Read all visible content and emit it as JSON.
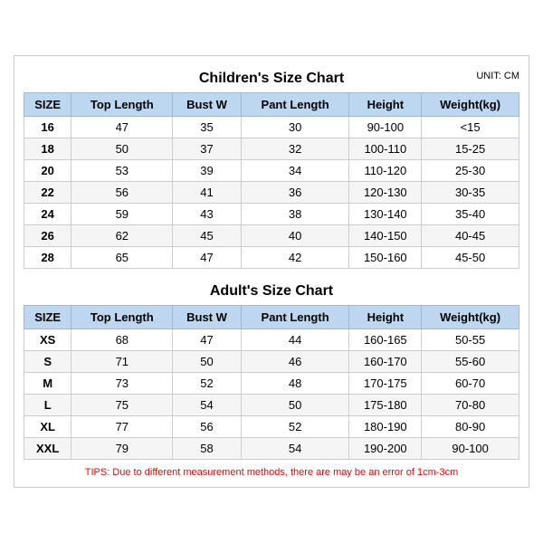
{
  "children": {
    "title": "Children's Size Chart",
    "unit": "UNIT: CM",
    "headers": [
      "SIZE",
      "Top Length",
      "Bust W",
      "Pant Length",
      "Height",
      "Weight(kg)"
    ],
    "rows": [
      [
        "16",
        "47",
        "35",
        "30",
        "90-100",
        "<15"
      ],
      [
        "18",
        "50",
        "37",
        "32",
        "100-110",
        "15-25"
      ],
      [
        "20",
        "53",
        "39",
        "34",
        "110-120",
        "25-30"
      ],
      [
        "22",
        "56",
        "41",
        "36",
        "120-130",
        "30-35"
      ],
      [
        "24",
        "59",
        "43",
        "38",
        "130-140",
        "35-40"
      ],
      [
        "26",
        "62",
        "45",
        "40",
        "140-150",
        "40-45"
      ],
      [
        "28",
        "65",
        "47",
        "42",
        "150-160",
        "45-50"
      ]
    ]
  },
  "adult": {
    "title": "Adult's Size Chart",
    "headers": [
      "SIZE",
      "Top Length",
      "Bust W",
      "Pant Length",
      "Height",
      "Weight(kg)"
    ],
    "rows": [
      [
        "XS",
        "68",
        "47",
        "44",
        "160-165",
        "50-55"
      ],
      [
        "S",
        "71",
        "50",
        "46",
        "160-170",
        "55-60"
      ],
      [
        "M",
        "73",
        "52",
        "48",
        "170-175",
        "60-70"
      ],
      [
        "L",
        "75",
        "54",
        "50",
        "175-180",
        "70-80"
      ],
      [
        "XL",
        "77",
        "56",
        "52",
        "180-190",
        "80-90"
      ],
      [
        "XXL",
        "79",
        "58",
        "54",
        "190-200",
        "90-100"
      ]
    ]
  },
  "tips": "TIPS: Due to different measurement methods, there are may be an error of 1cm-3cm"
}
